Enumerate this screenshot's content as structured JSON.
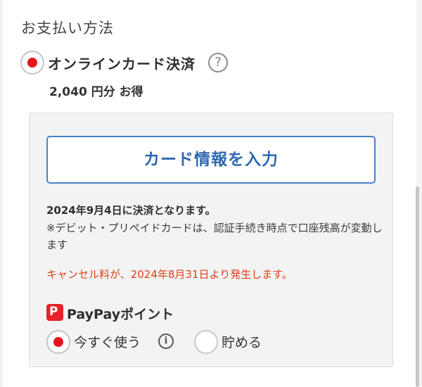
{
  "section_title": "お支払い方法",
  "payment_method": {
    "label": "オンラインカード決済",
    "help_icon": "?",
    "selected": true
  },
  "discount_text": "2,040 円分 お得",
  "card_button_label": "カード情報を入力",
  "settlement_note": "2024年9月4日に決済となります。",
  "debit_note": "※デビット・プリペイドカードは、認証手続き時点で口座残高が変動します",
  "cancel_note": "キャンセル料が、2024年8月31日より発生します。",
  "paypay": {
    "logo_text": "P",
    "label": "PayPayポイント",
    "option_use_now": "今すぐ使う",
    "option_save": "貯める",
    "info_icon": "i",
    "selected": "今すぐ使う"
  },
  "colors": {
    "accent_red": "#e8141e",
    "button_blue": "#2f68b0",
    "warning_red": "#e0401c"
  }
}
